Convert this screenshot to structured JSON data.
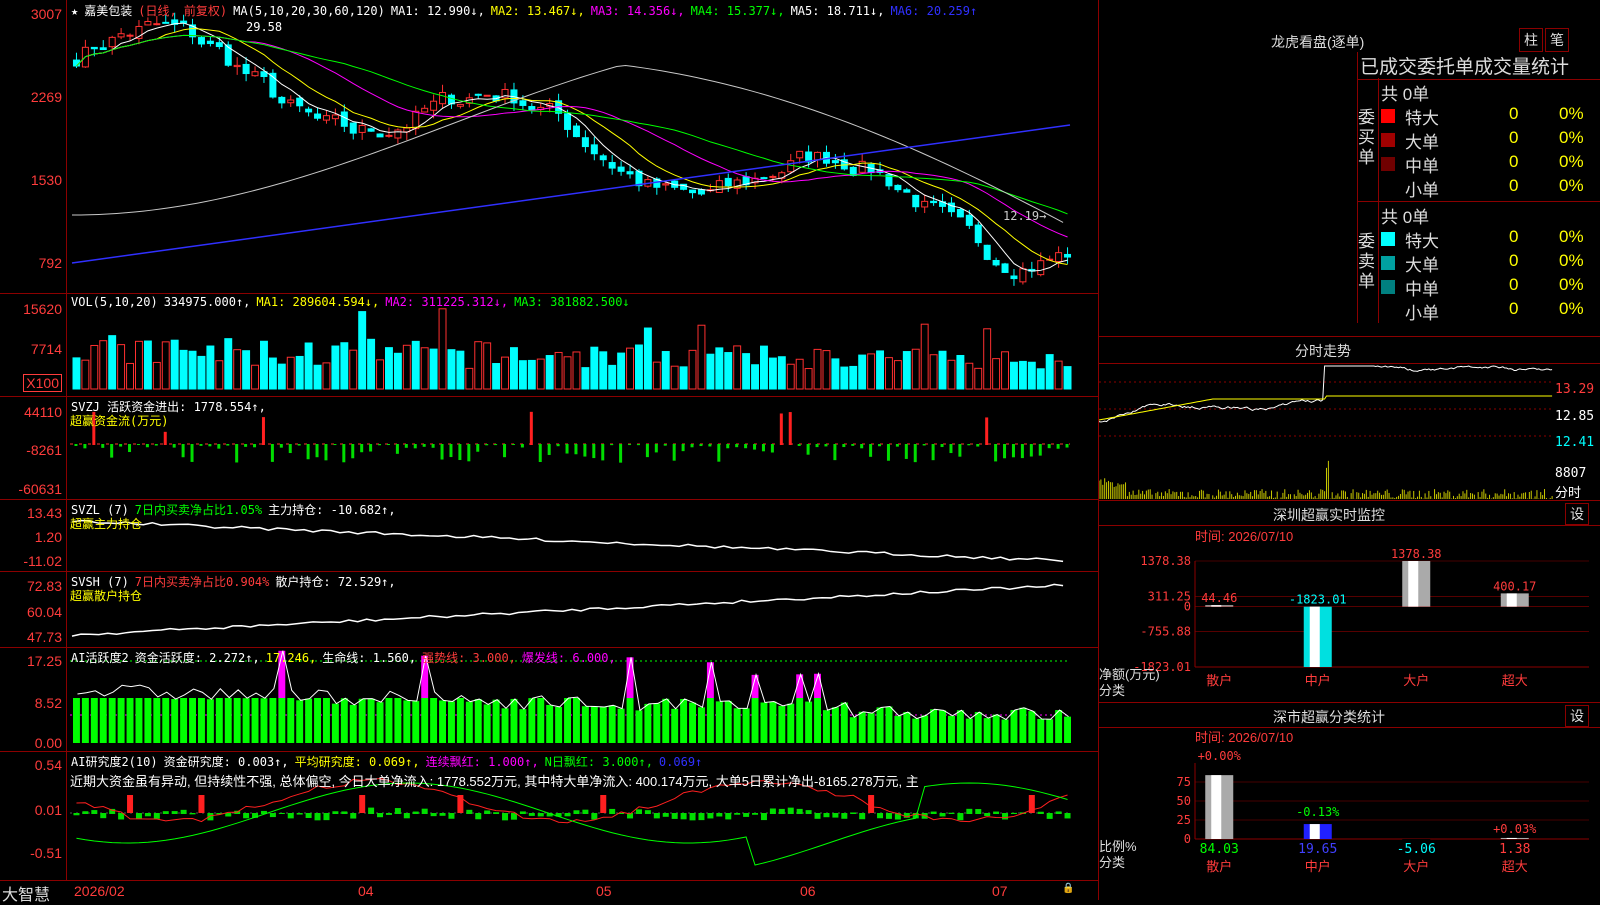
{
  "stock": {
    "name": "嘉美包装",
    "period": "(日线, 前复权)"
  },
  "price_panel": {
    "ticks": [
      "3007",
      "2269",
      "1530",
      "792"
    ],
    "ma_legend": [
      {
        "label": "MA(5,10,20,30,60,120)",
        "color": "#ffffff"
      },
      {
        "label": "MA1: 12.990↓,",
        "color": "#ffffff"
      },
      {
        "label": "MA2: 13.467↓,",
        "color": "#ffff00"
      },
      {
        "label": "MA3: 14.356↓,",
        "color": "#ff00ff"
      },
      {
        "label": "MA4: 15.377↓,",
        "color": "#00ff00"
      },
      {
        "label": "MA5: 18.711↓,",
        "color": "#ffffff"
      },
      {
        "label": "MA6: 20.259↑",
        "color": "#3030ff"
      }
    ],
    "high_label": "29.58",
    "low_label": "12.19→"
  },
  "vol_panel": {
    "ticks": [
      "15620",
      "7714",
      "X100"
    ],
    "legend": [
      {
        "label": "VOL(5,10,20)",
        "color": "#ffffff"
      },
      {
        "label": "334975.000↑,",
        "color": "#ffffff"
      },
      {
        "label": "MA1: 289604.594↓,",
        "color": "#ffff00"
      },
      {
        "label": "MA2: 311225.312↓,",
        "color": "#ff00ff"
      },
      {
        "label": "MA3: 381882.500↓",
        "color": "#00ff00"
      }
    ]
  },
  "svzj_panel": {
    "ticks": [
      "44110",
      "-8261",
      "-60631"
    ],
    "legend": [
      {
        "label": "SVZJ  活跃资金进出: 1778.554↑,",
        "color": "#ffffff"
      }
    ],
    "legend2": "超赢资金流(万元)"
  },
  "svzl_panel": {
    "ticks": [
      "13.43",
      "1.20",
      "-11.02"
    ],
    "legend": [
      {
        "label": "SVZL (7)",
        "color": "#ffffff"
      },
      {
        "label": "7日内买卖净占比1.05%",
        "color": "#00ff00"
      },
      {
        "label": "主力持仓: -10.682↑,",
        "color": "#ffffff"
      }
    ],
    "legend2": "超赢主力持仓"
  },
  "svsh_panel": {
    "ticks": [
      "72.83",
      "60.04",
      "47.73"
    ],
    "legend": [
      {
        "label": "SVSH (7)",
        "color": "#ffffff"
      },
      {
        "label": "7日内买卖净占比0.904%",
        "color": "#ff3c3c"
      },
      {
        "label": "散户持仓: 72.529↑,",
        "color": "#ffffff"
      }
    ],
    "legend2": "超赢散户持仓"
  },
  "ai_panel": {
    "ticks": [
      "17.25",
      "8.52",
      "0.00"
    ],
    "legend": [
      {
        "label": "AI活跃度2",
        "color": "#ffffff"
      },
      {
        "label": "资金活跃度: 2.272↑,",
        "color": "#ffffff"
      },
      {
        "label": "17.246,",
        "color": "#ffff00"
      },
      {
        "label": "生命线: 1.560,",
        "color": "#ffffff"
      },
      {
        "label": "强势线: 3.000,",
        "color": "#ff3c3c"
      },
      {
        "label": "爆发线: 6.000,",
        "color": "#ff00ff"
      }
    ]
  },
  "research_panel": {
    "ticks": [
      "0.54",
      "0.01",
      "-0.51"
    ],
    "legend": [
      {
        "label": "AI研究度2(10)",
        "color": "#ffffff"
      },
      {
        "label": "资金研究度: 0.003↑,",
        "color": "#ffffff"
      },
      {
        "label": "平均研究度: 0.069↑,",
        "color": "#ffff00"
      },
      {
        "label": "连续飘红: 1.000↑,",
        "color": "#ff00ff"
      },
      {
        "label": "N日飘红: 3.000↑,",
        "color": "#00ff00"
      },
      {
        "label": "0.069↑",
        "color": "#3030ff"
      }
    ],
    "comment": "近期大资金虽有异动, 但持续性不强, 总体偏空, 今日大单净流入: 1778.552万元, 其中特大单净流入: 400.174万元, 大单5日累计净出-8165.278万元, 主"
  },
  "xaxis": {
    "labels": [
      "2026/02",
      "04",
      "05",
      "06",
      "07"
    ],
    "brand": "大智慧"
  },
  "longhu": {
    "title": "龙虎看盘(逐单)",
    "btn_zhu": "柱",
    "btn_bi": "笔",
    "header": "已成交委托单成交量统计",
    "buy_label": "委买单",
    "sell_label": "委卖单",
    "buy_total": "共 0单",
    "sell_total": "共 0单",
    "buy_rows": [
      {
        "label": "特大",
        "value": "0",
        "pct": "0%",
        "color": "#ff0000"
      },
      {
        "label": "大单",
        "value": "0",
        "pct": "0%",
        "color": "#a00000"
      },
      {
        "label": "中单",
        "value": "0",
        "pct": "0%",
        "color": "#700000"
      },
      {
        "label": "小单",
        "value": "0",
        "pct": "0%",
        "color": "#000000"
      }
    ],
    "sell_rows": [
      {
        "label": "特大",
        "value": "0",
        "pct": "0%",
        "color": "#00ffff"
      },
      {
        "label": "大单",
        "value": "0",
        "pct": "0%",
        "color": "#00a0a0"
      },
      {
        "label": "中单",
        "value": "0",
        "pct": "0%",
        "color": "#008080"
      },
      {
        "label": "小单",
        "value": "0",
        "pct": "0%",
        "color": "#000000"
      }
    ]
  },
  "intraday": {
    "title": "分时走势",
    "ticks": [
      "13.29",
      "12.85",
      "12.41"
    ],
    "vol_tick": "8807",
    "vol_label": "分时"
  },
  "sz_monitor": {
    "title": "深圳超赢实时监控",
    "btn": "设",
    "date": "时间: 2026/07/10",
    "ticks": [
      "1378.38",
      "311.25",
      "0",
      "-755.88",
      "-1823.01"
    ],
    "ylabel": "净额(万元)",
    "xlabel": "分类",
    "categories": [
      "散户",
      "中户",
      "大户",
      "超大"
    ],
    "values": [
      44.46,
      -1823.01,
      1378.38,
      400.17
    ],
    "value_labels": [
      "44.46",
      "-1823.01",
      "1378.38",
      "400.17"
    ]
  },
  "sz_stats": {
    "title": "深市超赢分类统计",
    "btn": "设",
    "date": "时间: 2026/07/10",
    "ticks": [
      "75",
      "50",
      "25",
      "0"
    ],
    "ylabel": "比例%",
    "xlabel": "分类",
    "categories": [
      "散户",
      "中户",
      "大户",
      "超大"
    ],
    "top_labels": [
      "+0.00%",
      "-0.13%",
      "",
      "+0.03%"
    ],
    "values": [
      84.03,
      19.65,
      -5.06,
      1.38
    ],
    "bottom_labels": [
      "84.03",
      "19.65",
      "-5.06",
      "1.38"
    ]
  },
  "chart_data": {
    "type": "bar",
    "title": "深圳超赢实时监控",
    "categories": [
      "散户",
      "中户",
      "大户",
      "超大"
    ],
    "series": [
      {
        "name": "净额(万元)",
        "values": [
          44.46,
          -1823.01,
          1378.38,
          400.17
        ]
      }
    ]
  }
}
